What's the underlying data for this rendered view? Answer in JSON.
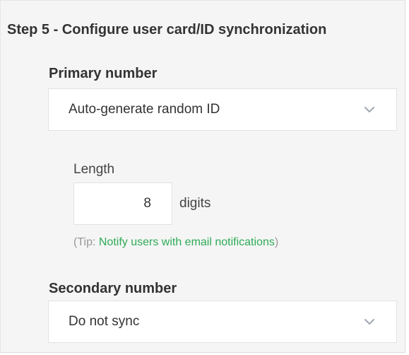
{
  "step": {
    "title": "Step 5 - Configure user card/ID synchronization"
  },
  "primary": {
    "label": "Primary number",
    "selected": "Auto-generate random ID",
    "chevron_icon": "chevron-down-icon"
  },
  "length": {
    "label": "Length",
    "value": "8",
    "unit": "digits"
  },
  "tip": {
    "prefix": "(Tip: ",
    "link": "Notify users with email notifications",
    "suffix": ")"
  },
  "secondary": {
    "label": "Secondary number",
    "selected": "Do not sync",
    "chevron_icon": "chevron-down-icon"
  },
  "colors": {
    "panel_background": "#f5f5f5",
    "link": "#2eab57",
    "chevron": "#a0a8b0"
  }
}
